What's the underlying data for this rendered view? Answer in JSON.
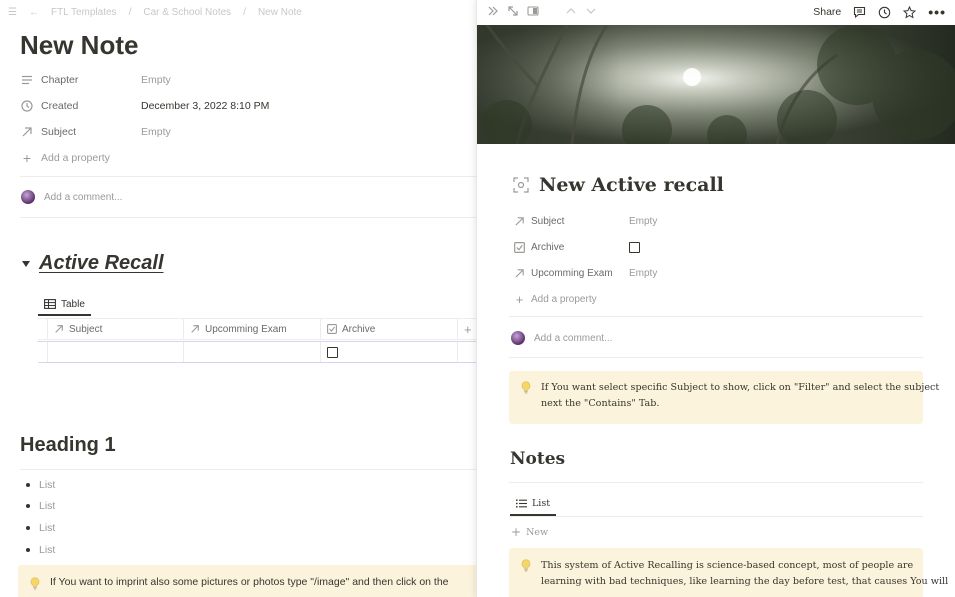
{
  "left": {
    "breadcrumb": [
      "FTL Templates",
      "Car & School Notes",
      "New Note"
    ],
    "title": "New Note",
    "properties": [
      {
        "icon": "text-lines-icon",
        "name": "Chapter",
        "value": "Empty"
      },
      {
        "icon": "clock-icon",
        "name": "Created",
        "value": "December 3, 2022 8:10 PM"
      },
      {
        "icon": "relation-arrow-icon",
        "name": "Subject",
        "value": "Empty"
      }
    ],
    "add_property": "Add a property",
    "comment_placeholder": "Add a comment...",
    "toggle_title": "Active Recall",
    "view_tab": "Table",
    "columns": [
      "Subject",
      "Upcomming Exam",
      "Archive"
    ],
    "heading": "Heading 1",
    "list_items": [
      "List",
      "List",
      "List",
      "List"
    ],
    "callout": "If You want to imprint also some pictures or photos type \"/image\" and then click on the"
  },
  "right": {
    "share_label": "Share",
    "title": "New Active recall",
    "properties": [
      {
        "icon": "relation-arrow-icon",
        "name": "Subject",
        "value": "Empty"
      },
      {
        "icon": "checkbox-icon",
        "name": "Archive",
        "value": ""
      },
      {
        "icon": "relation-arrow-icon",
        "name": "Upcomming Exam",
        "value": "Empty"
      }
    ],
    "add_property": "Add a property",
    "comment_placeholder": "Add a comment...",
    "callout_line1": "If You want select specific Subject to show, click on \"Filter\" and select the subject",
    "callout_line2": "next the \"Contains\" Tab.",
    "notes_heading": "Notes",
    "list_tab": "List",
    "new_label": "New",
    "callout2_line1": "This system of Active Recalling is science-based concept, most of people are",
    "callout2_line2": "learning with bad techniques, like learning the day before test, that causes You will"
  },
  "colors": {
    "text": "#37352f",
    "muted": "#9b9a97",
    "callout_bg": "#fbf3db",
    "selection": "#cfd8ef"
  }
}
